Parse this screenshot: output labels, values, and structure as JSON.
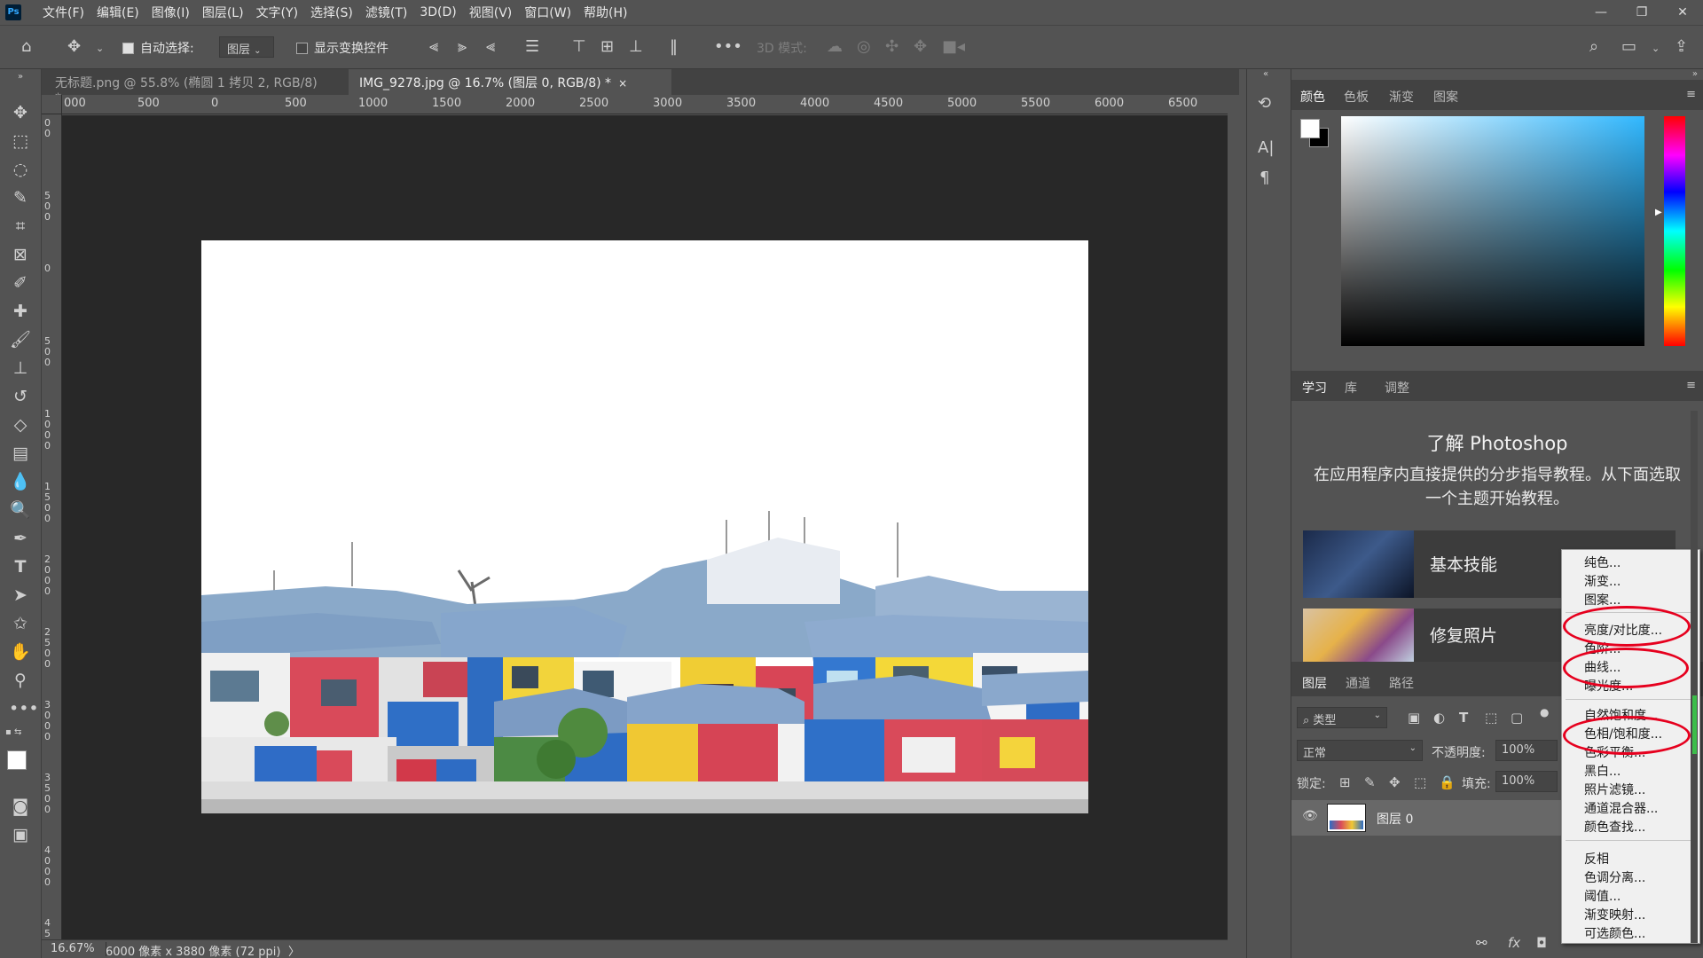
{
  "menubar": {
    "logo": "Ps",
    "items": [
      "文件(F)",
      "编辑(E)",
      "图像(I)",
      "图层(L)",
      "文字(Y)",
      "选择(S)",
      "滤镜(T)",
      "3D(D)",
      "视图(V)",
      "窗口(W)",
      "帮助(H)"
    ]
  },
  "options": {
    "auto_select_label": "自动选择:",
    "auto_select_value": "图层",
    "show_transform_label": "显示变换控件",
    "mode_3d_label": "3D 模式:"
  },
  "tabs": [
    {
      "label": "无标题.png @ 55.8% (椭圆 1 拷贝 2, RGB/8) *",
      "close": "×"
    },
    {
      "label": "IMG_9278.jpg @ 16.7% (图层 0, RGB/8) *",
      "close": "×"
    }
  ],
  "ruler_top_ticks": [
    "000",
    "500",
    "0",
    "500",
    "1000",
    "1500",
    "2000",
    "2500",
    "3000",
    "3500",
    "4000",
    "4500",
    "5000",
    "5500",
    "6000",
    "6500"
  ],
  "ruler_left_ticks": [
    "0 0",
    "5 0 0",
    "0",
    "5 0 0",
    "1 0 0 0",
    "1 5 0 0",
    "2 0 0 0",
    "2 5 0 0",
    "3 0 0 0",
    "3 5 0 0",
    "4 0 0 0",
    "4 5"
  ],
  "status": {
    "zoom": "16.67%",
    "doc_info": "6000 像素 x 3880 像素 (72 ppi)",
    "arrow": "〉"
  },
  "color_panel": {
    "tabs": [
      "颜色",
      "色板",
      "渐变",
      "图案"
    ]
  },
  "learn_panel": {
    "tabs": [
      "学习",
      "库",
      "调整"
    ],
    "title": "了解 Photoshop",
    "description": "在应用程序内直接提供的分步指导教程。从下面选取一个主题开始教程。",
    "cards": [
      "基本技能",
      "修复照片"
    ]
  },
  "layers_panel": {
    "tabs": [
      "图层",
      "通道",
      "路径"
    ],
    "filter_label": "类型",
    "blend_mode": "正常",
    "opacity_label": "不透明度:",
    "opacity_value": "100%",
    "lock_label": "锁定:",
    "fill_label": "填充:",
    "fill_value": "100%",
    "layer_name": "图层 0"
  },
  "context_menu": {
    "group1": [
      "纯色...",
      "渐变...",
      "图案..."
    ],
    "group2": [
      "亮度/对比度...",
      "色阶...",
      "曲线...",
      "曝光度..."
    ],
    "group3": [
      "自然饱和度...",
      "色相/饱和度...",
      "色彩平衡...",
      "黑白...",
      "照片滤镜...",
      "通道混合器...",
      "颜色查找..."
    ],
    "group4": [
      "反相",
      "色调分离...",
      "阈值...",
      "渐变映射...",
      "可选颜色..."
    ]
  },
  "highlight_color": "#e6001e"
}
